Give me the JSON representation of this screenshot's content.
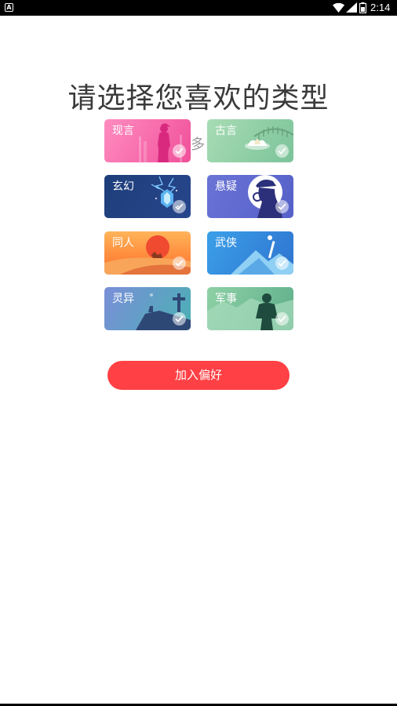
{
  "status_bar": {
    "app_icon_letter": "A",
    "time": "2:14"
  },
  "title": "请选择您喜欢的类型",
  "subtitle_peek": "多",
  "categories": [
    {
      "label": "现言",
      "icon": "woman-silhouette-icon"
    },
    {
      "label": "古言",
      "icon": "lotus-icon"
    },
    {
      "label": "玄幻",
      "icon": "crystal-lightning-icon"
    },
    {
      "label": "悬疑",
      "icon": "detective-magnifier-icon"
    },
    {
      "label": "同人",
      "icon": "desert-sunset-icon"
    },
    {
      "label": "武侠",
      "icon": "mountain-sword-icon"
    },
    {
      "label": "灵异",
      "icon": "graveyard-cross-icon"
    },
    {
      "label": "军事",
      "icon": "soldier-silhouette-icon"
    }
  ],
  "join_button": "加入偏好",
  "colors": {
    "button": "#ff4044",
    "title": "#3a3a3a"
  }
}
